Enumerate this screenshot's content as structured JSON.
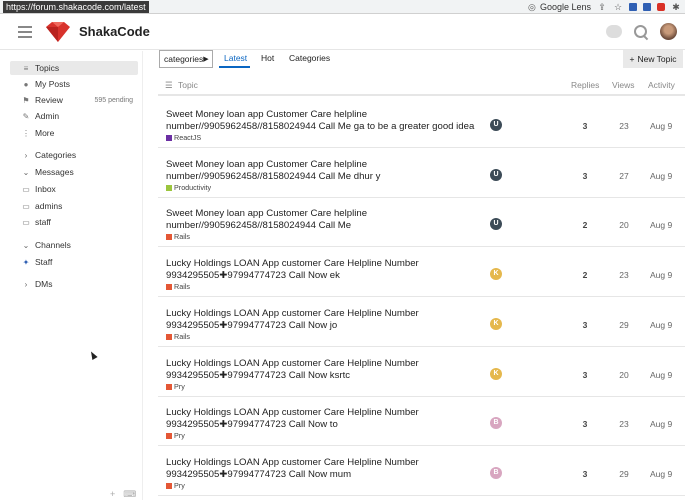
{
  "browser": {
    "url": "https://forum.shakacode.com/latest",
    "lens_label": "Google Lens"
  },
  "header": {
    "brand": "ShakaCode"
  },
  "sidebar": {
    "items": [
      {
        "label": "Topics",
        "icon": "layers-icon",
        "active": true
      },
      {
        "label": "My Posts",
        "icon": "user-icon"
      },
      {
        "label": "Review",
        "icon": "flag-icon",
        "count": "595 pending"
      },
      {
        "label": "Admin",
        "icon": "wrench-icon"
      },
      {
        "label": "More",
        "icon": "more-vertical-icon"
      }
    ],
    "categories_label": "Categories",
    "messages_label": "Messages",
    "message_items": [
      {
        "label": "Inbox",
        "icon": "inbox-icon"
      },
      {
        "label": "admins",
        "icon": "inbox-icon"
      },
      {
        "label": "staff",
        "icon": "inbox-icon"
      }
    ],
    "channels_label": "Channels",
    "channel_items": [
      {
        "label": "Staff",
        "icon": "users-icon"
      }
    ],
    "dms_label": "DMs"
  },
  "toolbar": {
    "categories_dropdown": "categories",
    "tabs": [
      "Latest",
      "Hot",
      "Categories"
    ],
    "active_tab": "Latest",
    "new_topic_label": "New Topic"
  },
  "list_header": {
    "topic": "Topic",
    "replies": "Replies",
    "views": "Views",
    "activity": "Activity"
  },
  "topics": [
    {
      "title": "Sweet Money loan app Customer Care helpline number//9905962458//8158024944 Call Me ga to be a greater good idea",
      "category": "ReactJS",
      "category_color": "#6b2fa3",
      "avatar": "U",
      "avatar_color": "#3c4b57",
      "replies": "3",
      "views": "23",
      "activity": "Aug 9"
    },
    {
      "title": "Sweet Money loan app Customer Care helpline number//9905962458//8158024944 Call Me dhur y",
      "category": "Productivity",
      "category_color": "#9bc53d",
      "avatar": "U",
      "avatar_color": "#3c4b57",
      "replies": "3",
      "views": "27",
      "activity": "Aug 9"
    },
    {
      "title": "Sweet Money loan app Customer Care helpline number//9905962458//8158024944 Call Me",
      "category": "Rails",
      "category_color": "#e45735",
      "avatar": "U",
      "avatar_color": "#3c4b57",
      "replies": "2",
      "views": "20",
      "activity": "Aug 9"
    },
    {
      "title": "Lucky Holdings LOAN App customer Care Helpline Number 9934295505✚97994774723 Call Now ek",
      "category": "Rails",
      "category_color": "#e45735",
      "avatar": "K",
      "avatar_color": "#e5b84d",
      "replies": "2",
      "views": "23",
      "activity": "Aug 9"
    },
    {
      "title": "Lucky Holdings LOAN App customer Care Helpline Number 9934295505✚97994774723 Call Now jo",
      "category": "Rails",
      "category_color": "#e45735",
      "avatar": "K",
      "avatar_color": "#e5b84d",
      "replies": "3",
      "views": "29",
      "activity": "Aug 9"
    },
    {
      "title": "Lucky Holdings LOAN App customer Care Helpline Number 9934295505✚97994774723 Call Now ksrtc",
      "category": "Pry",
      "category_color": "#e45735",
      "avatar": "K",
      "avatar_color": "#e5b84d",
      "replies": "3",
      "views": "20",
      "activity": "Aug 9"
    },
    {
      "title": "Lucky Holdings LOAN App customer Care Helpline Number 9934295505✚97994774723 Call Now to",
      "category": "Pry",
      "category_color": "#e45735",
      "avatar": "B",
      "avatar_color": "#d8a6c0",
      "replies": "3",
      "views": "23",
      "activity": "Aug 9"
    },
    {
      "title": "Lucky Holdings LOAN App customer Care Helpline Number 9934295505✚97994774723 Call Now mum",
      "category": "Pry",
      "category_color": "#e45735",
      "avatar": "B",
      "avatar_color": "#d8a6c0",
      "replies": "3",
      "views": "29",
      "activity": "Aug 9"
    }
  ]
}
